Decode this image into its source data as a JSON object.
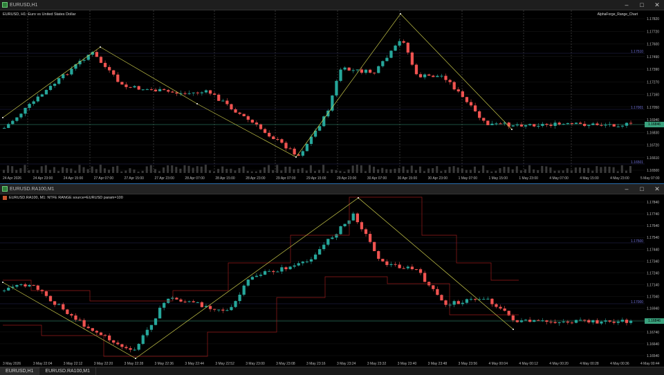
{
  "window1": {
    "title": "EURUSD,H1",
    "info": "EURUSD, H1:  Euro vs United States Dollar",
    "indicator": "AlphaForge_Range_Chart",
    "price_ticks": [
      "1.17820",
      "1.17720",
      "1.17600",
      "1.17490",
      "1.17390",
      "1.17270",
      "1.17160",
      "1.17050",
      "1.16940",
      "1.16830",
      "1.16720",
      "1.16610",
      "1.16500"
    ],
    "level_labels": [
      "1.17510",
      "1.17001",
      "1.16501"
    ],
    "current_price": "1.16846",
    "time_ticks": [
      "24 Apr 2026",
      "24 Apr 23:00",
      "24 Apr 15:00",
      "27 Apr 07:00",
      "27 Apr 15:00",
      "27 Apr 23:00",
      "28 Apr 07:00",
      "28 Apr 15:00",
      "28 Apr 23:00",
      "29 Apr 07:00",
      "29 Apr 15:00",
      "29 Apr 23:00",
      "30 Apr 07:00",
      "30 Apr 15:00",
      "30 Apr 23:00",
      "1 May 07:00",
      "1 May 15:00",
      "1 May 23:00",
      "4 May 07:00",
      "4 May 15:00",
      "4 May 23:00",
      "5 May 07:00"
    ]
  },
  "window2": {
    "title": "EURUSD.RA100,M1",
    "info": "EURUSD.RA100, M1:  NTFE RANGE source=EURUSD param=100",
    "price_ticks": [
      "1.17840",
      "1.17740",
      "1.17640",
      "1.17540",
      "1.17440",
      "1.17340",
      "1.17240",
      "1.17140",
      "1.17040",
      "1.16940",
      "1.16840",
      "1.16740",
      "1.16640",
      "1.16540"
    ],
    "level_labels": [
      "1.17500",
      "1.17000"
    ],
    "current_price": "1.16846",
    "time_ticks": [
      "3 May 2026",
      "3 May 22:04",
      "3 May 22:12",
      "3 May 22:20",
      "3 May 22:28",
      "3 May 22:36",
      "3 May 22:44",
      "3 May 22:52",
      "3 May 23:00",
      "3 May 23:08",
      "3 May 23:16",
      "3 May 23:24",
      "3 May 23:32",
      "3 May 23:40",
      "3 May 23:48",
      "3 May 23:56",
      "4 May 00:04",
      "4 May 00:12",
      "4 May 00:20",
      "4 May 00:28",
      "4 May 00:36",
      "4 May 00:44"
    ]
  },
  "tabs": [
    "EURUSD,H1",
    "EURUSD.RA100,M1"
  ],
  "colors": {
    "bull": "#26a69a",
    "bear": "#ef5350",
    "zigzag": "#c9c94a",
    "channel": "#9b1b1b"
  }
}
